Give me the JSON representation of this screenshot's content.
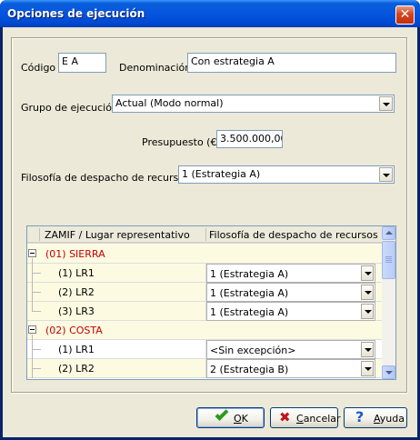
{
  "window": {
    "title": "Opciones de ejecución"
  },
  "form": {
    "codigo_label": "Código",
    "codigo_value": "E A",
    "denominacion_label": "Denominación",
    "denominacion_value": "Con estrategia A",
    "grupo_label": "Grupo de ejecución",
    "grupo_value": "Actual (Modo normal)",
    "presupuesto_label": "Presupuesto (€)",
    "presupuesto_value": "3.500.000,00",
    "filosofia_label": "Filosofía de despacho de recursos",
    "filosofia_value": "1 (Estrategia A)"
  },
  "grid": {
    "columns": [
      "ZAMIF / Lugar representativo",
      "Filosofía de despacho de recursos"
    ],
    "rows": [
      {
        "type": "group",
        "label": "(01) SIERRA"
      },
      {
        "type": "item",
        "label": "(1) LR1",
        "value": "1 (Estrategia A)"
      },
      {
        "type": "item",
        "label": "(2) LR2",
        "value": "1 (Estrategia A)"
      },
      {
        "type": "item",
        "label": "(3) LR3",
        "value": "1 (Estrategia A)"
      },
      {
        "type": "group",
        "label": "(02) COSTA"
      },
      {
        "type": "item",
        "label": "(1) LR1",
        "value": "<Sin excepción>"
      },
      {
        "type": "item",
        "label": "(2) LR2",
        "value": "2 (Estrategia B)"
      }
    ]
  },
  "buttons": {
    "ok": {
      "label_u": "O",
      "label_rest": "K"
    },
    "cancel": {
      "label_u": "C",
      "label_rest": "ancelar"
    },
    "help": {
      "label_u": "A",
      "label_rest": "yuda"
    }
  },
  "icons": {
    "close": "close-icon",
    "ok": "checkmark-icon",
    "cancel": "cross-icon",
    "help": "question-mark-icon"
  },
  "colors": {
    "title_bar": "#0555e0",
    "dialog_bg": "#ece9d8",
    "group_text": "#c00000",
    "row_highlight": "#fcfbe2"
  }
}
